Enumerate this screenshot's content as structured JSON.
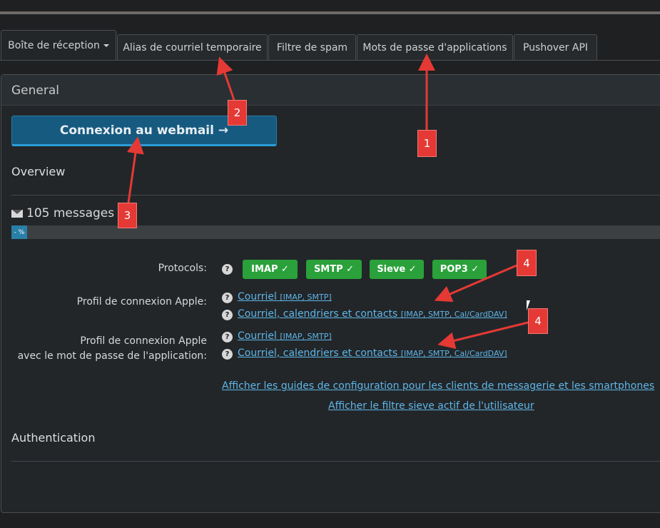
{
  "tabs": [
    {
      "label": "Boîte de réception",
      "active": true,
      "dropdown": true
    },
    {
      "label": "Alias de courriel temporaire"
    },
    {
      "label": "Filtre de spam"
    },
    {
      "label": "Mots de passe d'applications"
    },
    {
      "label": "Pushover API"
    }
  ],
  "panel": {
    "title": "General"
  },
  "webmail_button": "Connexion au webmail →",
  "overview": {
    "title": "Overview",
    "messages": "105 messages",
    "progress_label": "- %"
  },
  "protocols": {
    "label": "Protocols:",
    "badges": [
      "IMAP ✓",
      "SMTP ✓",
      "Sieve ✓",
      "POP3 ✓"
    ],
    "badge_color": "#2aa13a"
  },
  "apple_profile": {
    "label": "Profil de connexion Apple:",
    "links": [
      {
        "text": "Courriel",
        "tags": "[IMAP, SMTP]"
      },
      {
        "text": "Courriel, calendriers et contacts",
        "tags": "[IMAP, SMTP, Cal/CardDAV]"
      }
    ]
  },
  "apple_profile_app": {
    "label_line1": "Profil de connexion Apple",
    "label_line2": "avec le mot de passe de l'application:",
    "links": [
      {
        "text": "Courriel",
        "tags": "[IMAP, SMTP]"
      },
      {
        "text": "Courriel, calendriers et contacts",
        "tags": "[IMAP, SMTP, Cal/CardDAV]"
      }
    ]
  },
  "guides_link": "Afficher les guides de configuration pour les clients de messagerie et les smartphones",
  "sieve_link": "Afficher le filtre sieve actif de l'utilisateur",
  "authentication": {
    "title": "Authentication"
  },
  "help_icon": "?",
  "annotations": [
    "1",
    "2",
    "3",
    "4",
    "4"
  ],
  "annotation_color": "#e53935"
}
